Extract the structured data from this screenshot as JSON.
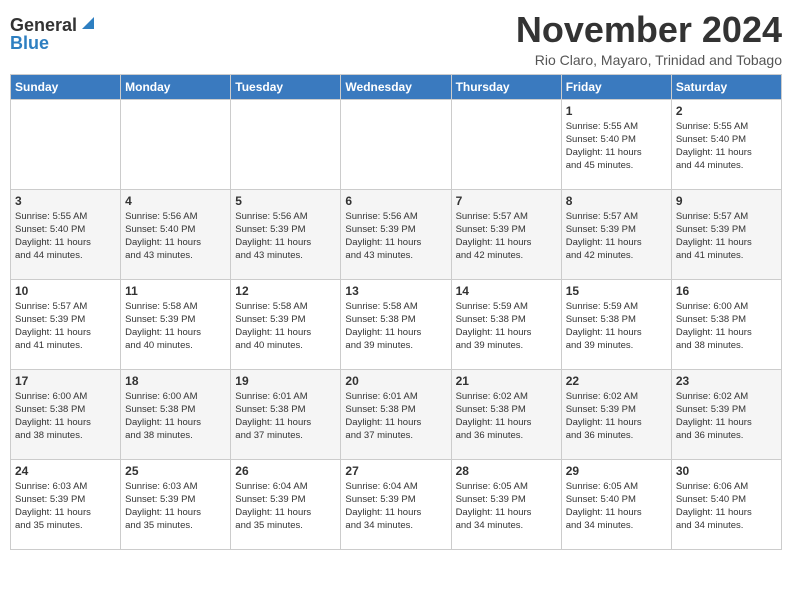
{
  "header": {
    "logo_general": "General",
    "logo_blue": "Blue",
    "month_title": "November 2024",
    "location": "Rio Claro, Mayaro, Trinidad and Tobago"
  },
  "weekdays": [
    "Sunday",
    "Monday",
    "Tuesday",
    "Wednesday",
    "Thursday",
    "Friday",
    "Saturday"
  ],
  "weeks": [
    [
      {
        "day": "",
        "info": ""
      },
      {
        "day": "",
        "info": ""
      },
      {
        "day": "",
        "info": ""
      },
      {
        "day": "",
        "info": ""
      },
      {
        "day": "",
        "info": ""
      },
      {
        "day": "1",
        "info": "Sunrise: 5:55 AM\nSunset: 5:40 PM\nDaylight: 11 hours\nand 45 minutes."
      },
      {
        "day": "2",
        "info": "Sunrise: 5:55 AM\nSunset: 5:40 PM\nDaylight: 11 hours\nand 44 minutes."
      }
    ],
    [
      {
        "day": "3",
        "info": "Sunrise: 5:55 AM\nSunset: 5:40 PM\nDaylight: 11 hours\nand 44 minutes."
      },
      {
        "day": "4",
        "info": "Sunrise: 5:56 AM\nSunset: 5:40 PM\nDaylight: 11 hours\nand 43 minutes."
      },
      {
        "day": "5",
        "info": "Sunrise: 5:56 AM\nSunset: 5:39 PM\nDaylight: 11 hours\nand 43 minutes."
      },
      {
        "day": "6",
        "info": "Sunrise: 5:56 AM\nSunset: 5:39 PM\nDaylight: 11 hours\nand 43 minutes."
      },
      {
        "day": "7",
        "info": "Sunrise: 5:57 AM\nSunset: 5:39 PM\nDaylight: 11 hours\nand 42 minutes."
      },
      {
        "day": "8",
        "info": "Sunrise: 5:57 AM\nSunset: 5:39 PM\nDaylight: 11 hours\nand 42 minutes."
      },
      {
        "day": "9",
        "info": "Sunrise: 5:57 AM\nSunset: 5:39 PM\nDaylight: 11 hours\nand 41 minutes."
      }
    ],
    [
      {
        "day": "10",
        "info": "Sunrise: 5:57 AM\nSunset: 5:39 PM\nDaylight: 11 hours\nand 41 minutes."
      },
      {
        "day": "11",
        "info": "Sunrise: 5:58 AM\nSunset: 5:39 PM\nDaylight: 11 hours\nand 40 minutes."
      },
      {
        "day": "12",
        "info": "Sunrise: 5:58 AM\nSunset: 5:39 PM\nDaylight: 11 hours\nand 40 minutes."
      },
      {
        "day": "13",
        "info": "Sunrise: 5:58 AM\nSunset: 5:38 PM\nDaylight: 11 hours\nand 39 minutes."
      },
      {
        "day": "14",
        "info": "Sunrise: 5:59 AM\nSunset: 5:38 PM\nDaylight: 11 hours\nand 39 minutes."
      },
      {
        "day": "15",
        "info": "Sunrise: 5:59 AM\nSunset: 5:38 PM\nDaylight: 11 hours\nand 39 minutes."
      },
      {
        "day": "16",
        "info": "Sunrise: 6:00 AM\nSunset: 5:38 PM\nDaylight: 11 hours\nand 38 minutes."
      }
    ],
    [
      {
        "day": "17",
        "info": "Sunrise: 6:00 AM\nSunset: 5:38 PM\nDaylight: 11 hours\nand 38 minutes."
      },
      {
        "day": "18",
        "info": "Sunrise: 6:00 AM\nSunset: 5:38 PM\nDaylight: 11 hours\nand 38 minutes."
      },
      {
        "day": "19",
        "info": "Sunrise: 6:01 AM\nSunset: 5:38 PM\nDaylight: 11 hours\nand 37 minutes."
      },
      {
        "day": "20",
        "info": "Sunrise: 6:01 AM\nSunset: 5:38 PM\nDaylight: 11 hours\nand 37 minutes."
      },
      {
        "day": "21",
        "info": "Sunrise: 6:02 AM\nSunset: 5:38 PM\nDaylight: 11 hours\nand 36 minutes."
      },
      {
        "day": "22",
        "info": "Sunrise: 6:02 AM\nSunset: 5:39 PM\nDaylight: 11 hours\nand 36 minutes."
      },
      {
        "day": "23",
        "info": "Sunrise: 6:02 AM\nSunset: 5:39 PM\nDaylight: 11 hours\nand 36 minutes."
      }
    ],
    [
      {
        "day": "24",
        "info": "Sunrise: 6:03 AM\nSunset: 5:39 PM\nDaylight: 11 hours\nand 35 minutes."
      },
      {
        "day": "25",
        "info": "Sunrise: 6:03 AM\nSunset: 5:39 PM\nDaylight: 11 hours\nand 35 minutes."
      },
      {
        "day": "26",
        "info": "Sunrise: 6:04 AM\nSunset: 5:39 PM\nDaylight: 11 hours\nand 35 minutes."
      },
      {
        "day": "27",
        "info": "Sunrise: 6:04 AM\nSunset: 5:39 PM\nDaylight: 11 hours\nand 34 minutes."
      },
      {
        "day": "28",
        "info": "Sunrise: 6:05 AM\nSunset: 5:39 PM\nDaylight: 11 hours\nand 34 minutes."
      },
      {
        "day": "29",
        "info": "Sunrise: 6:05 AM\nSunset: 5:40 PM\nDaylight: 11 hours\nand 34 minutes."
      },
      {
        "day": "30",
        "info": "Sunrise: 6:06 AM\nSunset: 5:40 PM\nDaylight: 11 hours\nand 34 minutes."
      }
    ]
  ]
}
